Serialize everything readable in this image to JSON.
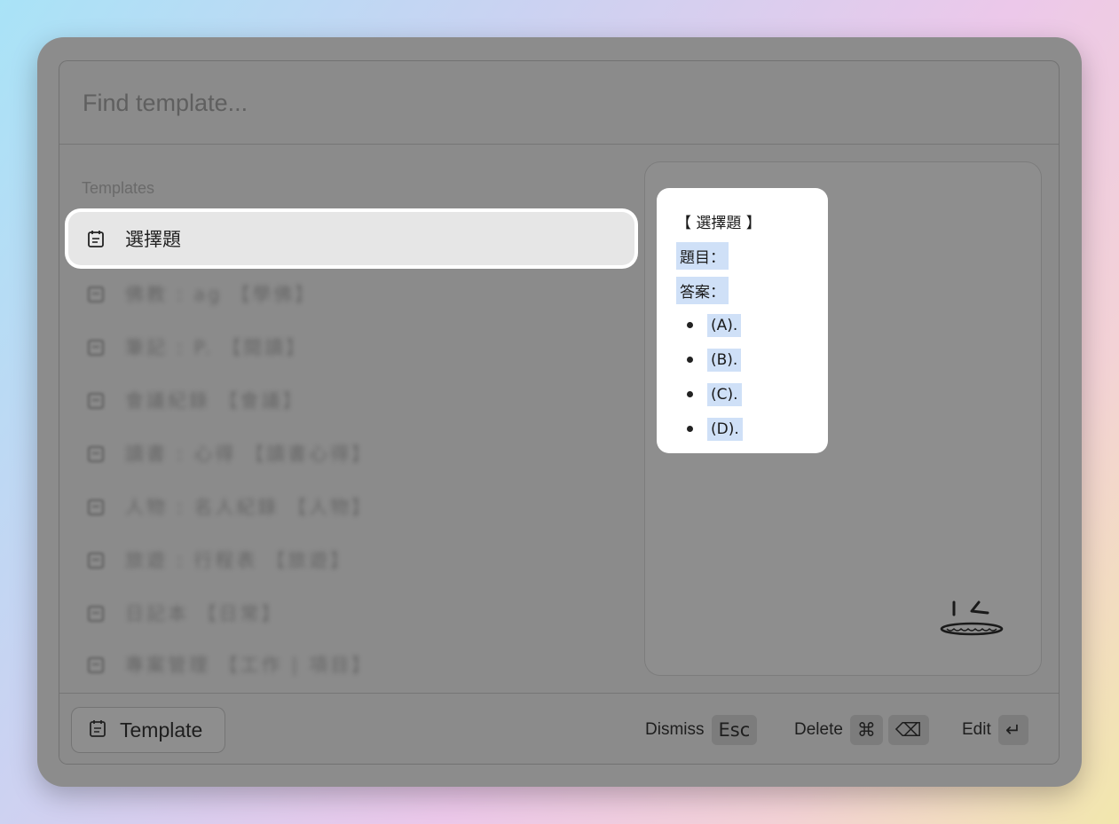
{
  "search": {
    "placeholder": "Find template..."
  },
  "list": {
    "section_label": "Templates",
    "items": [
      {
        "label": "選擇題",
        "selected": true
      },
      {
        "label": "佛教 : ag 【學佛】",
        "blurred": true
      },
      {
        "label": "筆記 : P. 【閱讀】",
        "blurred": true
      },
      {
        "label": "會議紀錄 【會議】",
        "blurred": true
      },
      {
        "label": "讀書 : 心得 【讀書心得】",
        "blurred": true
      },
      {
        "label": "人物 : 名人紀錄 【人物】",
        "blurred": true
      },
      {
        "label": "旅遊 : 行程表 【旅遊】",
        "blurred": true
      },
      {
        "label": "日記本 【日常】",
        "blurred": true
      },
      {
        "label": "專案管理 【工作 | 項目】",
        "blurred": true
      }
    ]
  },
  "preview": {
    "title": "【 選擇題 】",
    "question": "題目：",
    "answer": "答案：",
    "options": [
      "(A).",
      "(B).",
      "(C).",
      "(D)."
    ]
  },
  "footer": {
    "template_button": "Template",
    "dismiss_label": "Dismiss",
    "dismiss_key": "Esc",
    "delete_label": "Delete",
    "delete_key_cmd": "⌘",
    "delete_key_backspace": "⌫",
    "edit_label": "Edit",
    "edit_key": "↵"
  },
  "icons": {
    "template_icon": "notepad-icon",
    "mascot": "smiley-mascot-icon"
  }
}
